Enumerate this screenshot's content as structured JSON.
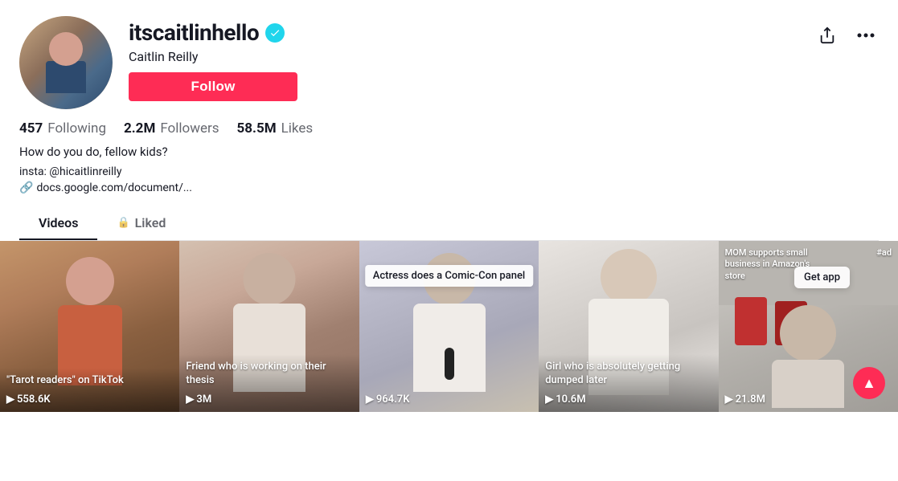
{
  "profile": {
    "username": "itscaitlinhello",
    "display_name": "Caitlin Reilly",
    "verified": true,
    "follow_label": "Follow",
    "stats": {
      "following_count": "457",
      "following_label": "Following",
      "followers_count": "2.2M",
      "followers_label": "Followers",
      "likes_count": "58.5M",
      "likes_label": "Likes"
    },
    "bio": "How do you do, fellow kids?",
    "insta": "insta: @hicaitlinreilly",
    "link": "docs.google.com/document/..."
  },
  "tabs": [
    {
      "label": "Videos",
      "active": true,
      "locked": false
    },
    {
      "label": "Liked",
      "active": false,
      "locked": true
    }
  ],
  "videos": [
    {
      "caption": "\"Tarot readers\" on TikTok",
      "views": "558.6K",
      "tooltip": null,
      "thumb_class": "thumb-1"
    },
    {
      "caption": "Friend who is working on their thesis",
      "views": "3M",
      "tooltip": null,
      "thumb_class": "thumb-2"
    },
    {
      "caption": "Actress does a Comic-Con panel",
      "views": "964.7K",
      "tooltip": "Actress does a Comic-Con panel",
      "thumb_class": "thumb-3"
    },
    {
      "caption": "Girl who is absolutely getting dumped later",
      "views": "10.6M",
      "tooltip": null,
      "thumb_class": "thumb-4"
    },
    {
      "caption": "MOM supports small business in Amazon's store",
      "views": "21.8M",
      "tooltip": null,
      "thumb_class": "thumb-5"
    }
  ],
  "ui": {
    "share_icon": "↗",
    "more_icon": "•••",
    "play_icon": "▶",
    "link_icon": "🔗",
    "lock_icon": "🔒",
    "scroll_top_icon": "▲",
    "get_app_label": "Get app",
    "ad_label": "#ad"
  }
}
